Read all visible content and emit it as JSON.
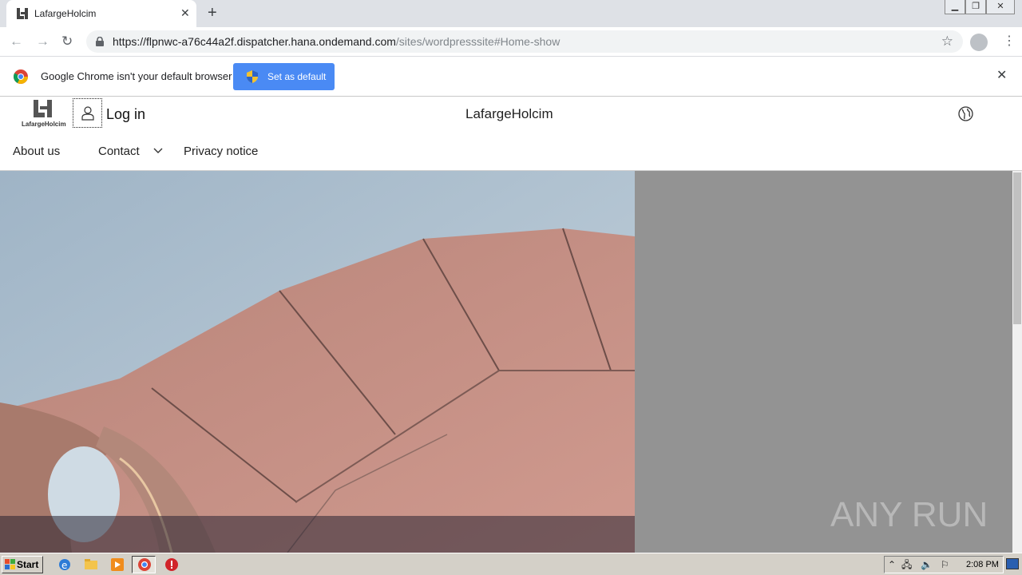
{
  "browser": {
    "tab_title": "LafargeHolcim",
    "url_main": "https://flpnwc-a76c44a2f.dispatcher.hana.ondemand.com",
    "url_path": "/sites/wordpresssite#Home-show"
  },
  "infobar": {
    "message": "Google Chrome isn't your default browser",
    "button_label": "Set as default"
  },
  "site": {
    "logo_text": "LafargeHolcim",
    "login_label": "Log in",
    "title": "LafargeHolcim",
    "nav": {
      "about": "About us",
      "contact": "Contact",
      "privacy": "Privacy notice"
    }
  },
  "watermark": "ANY RUN",
  "taskbar": {
    "start_label": "Start",
    "clock": "2:08 PM"
  },
  "colors": {
    "accent_button": "#4a8af4",
    "hero_sky": "#a9bccb",
    "hero_concrete": "#c88f85",
    "side_panel": "#939393"
  }
}
